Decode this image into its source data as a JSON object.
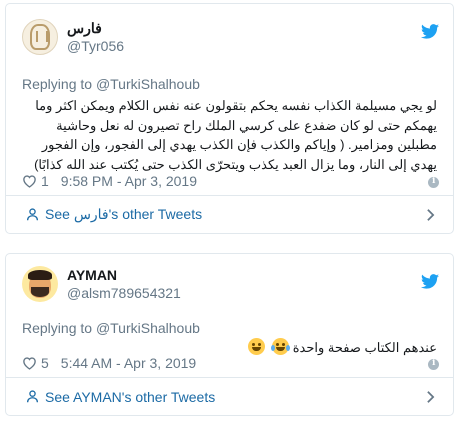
{
  "tweets": [
    {
      "display_name": "فارس",
      "handle": "@Tyr056",
      "replying_prefix": "Replying to ",
      "replying_to": "@TurkiShalhoub",
      "text": "لو يجي مسيلمة الكذاب نفسه يحكم بتقولون عنه نفس الكلام ويمكن اكثر وما يهمكم حتى لو كان ضفدع على كرسي الملك راح تصيرون له نعل وحاشية مطبلين ومزامير. ( وإياكم والكذب فإن الكذب يهدي إلى الفجور، وإن الفجور يهدي إلى النار، وما يزال العبد يكذب ويتحرّى الكذب حتى يُكتب عند الله كذابًا)",
      "likes": "1",
      "timestamp": "9:58 PM - Apr 3, 2019",
      "footer_link": "See فارس's other Tweets",
      "avatar_icon": "seal-avatar-icon"
    },
    {
      "display_name": "AYMAN",
      "handle": "@alsm789654321",
      "replying_prefix": "Replying to ",
      "replying_to": "@TurkiShalhoub",
      "text": "عندهم الكتاب صفحة واحدة",
      "likes": "5",
      "timestamp": "5:44 AM - Apr 3, 2019",
      "footer_link": "See AYMAN's other Tweets",
      "avatar_icon": "cartoon-avatar-icon"
    }
  ],
  "icons": {
    "bird": "twitter-bird-icon",
    "heart": "heart-icon",
    "info": "info-icon",
    "user": "user-icon",
    "chevron": "chevron-right-icon",
    "emoji": "tears-of-joy-emoji-icon"
  },
  "colors": {
    "twitter_blue": "#1da1f2",
    "link_blue": "#1b6aa5",
    "muted": "#657786",
    "border": "#e1e8ed"
  }
}
